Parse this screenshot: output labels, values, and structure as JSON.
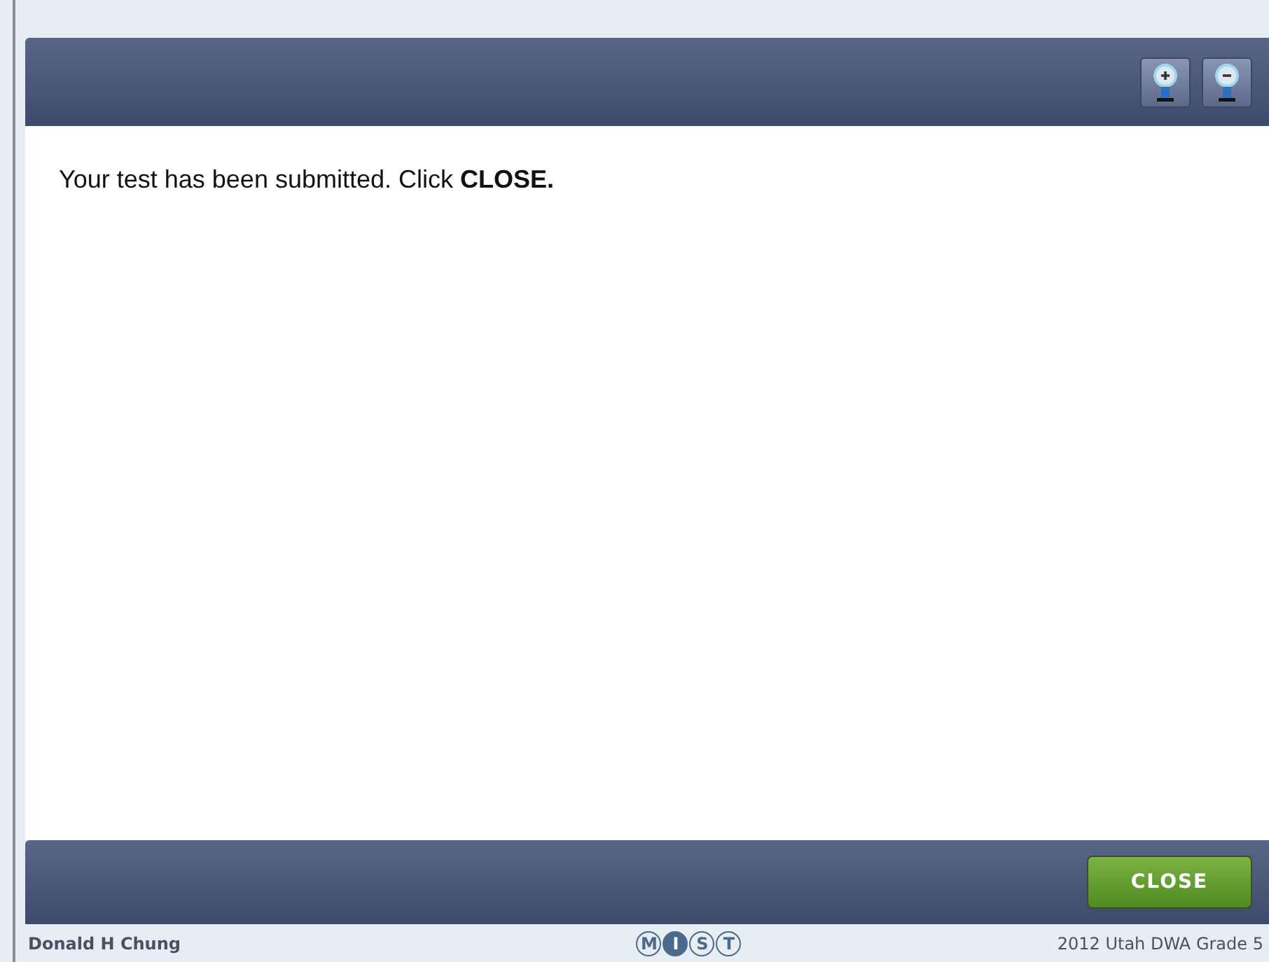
{
  "message": "Your test has been submitted. Click **CLOSE.**",
  "toolbar": {
    "buttons": [
      {
        "kind": "zoom_in"
      },
      {
        "kind": "zoom_out"
      }
    ]
  },
  "footer": {
    "button": "CLOSE"
  },
  "status_bar": {
    "student": "Donald H Chung",
    "logo_letters": [
      {
        "letter": "M",
        "filled": false
      },
      {
        "letter": "I",
        "filled": true
      },
      {
        "letter": "S",
        "filled": false
      },
      {
        "letter": "T",
        "filled": false
      }
    ],
    "test_name": "2012 Utah DWA Grade 5"
  }
}
